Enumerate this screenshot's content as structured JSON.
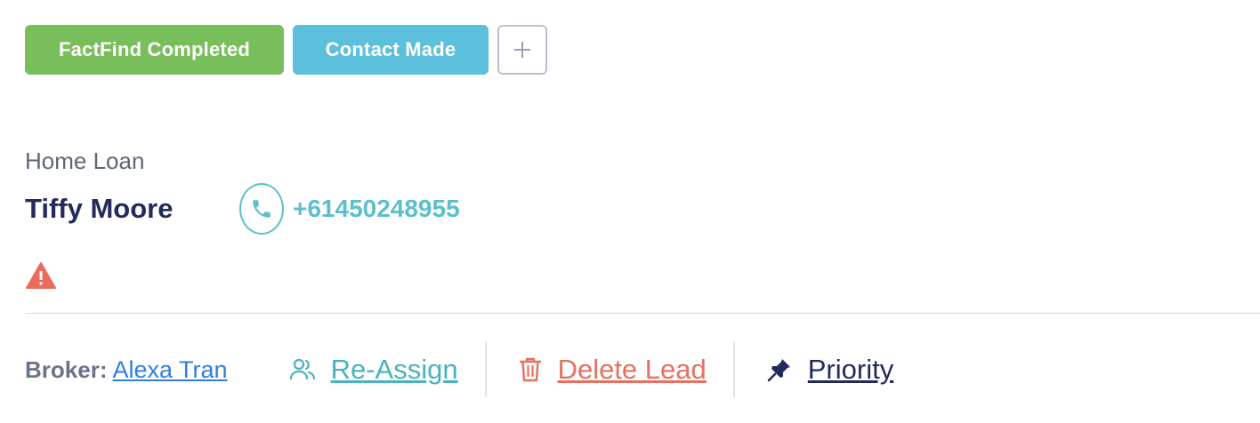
{
  "tags": {
    "items": [
      {
        "label": "FactFind Completed",
        "color": "#78bf5c"
      },
      {
        "label": "Contact Made",
        "color": "#5cbfdc"
      }
    ],
    "add_icon": "plus-icon"
  },
  "lead": {
    "loan_type": "Home Loan",
    "client_name": "Tiffy Moore",
    "phone_icon": "phone-icon",
    "phone": "+61450248955",
    "warning_icon": "warning-icon"
  },
  "footer": {
    "broker_label": "Broker:",
    "broker_name": "Alexa Tran",
    "reassign_label": "Re-Assign",
    "reassign_icon": "users-icon",
    "delete_label": "Delete Lead",
    "delete_icon": "trash-icon",
    "priority_label": "Priority",
    "priority_icon": "pin-icon"
  },
  "colors": {
    "accent_teal": "#5cbfcc",
    "danger": "#e8705f",
    "navy": "#232a5c",
    "link_blue": "#2f7ee6"
  }
}
